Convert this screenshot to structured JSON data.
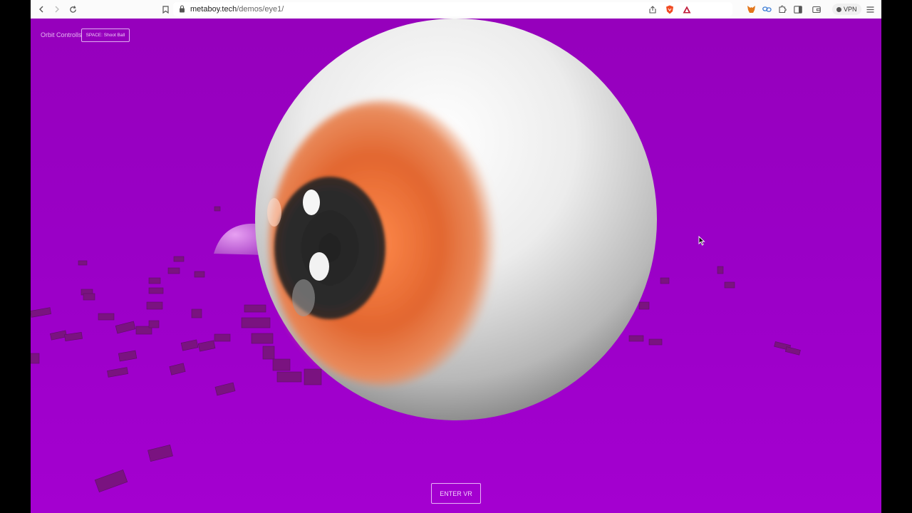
{
  "browser": {
    "url_host": "metaboy.tech",
    "url_path": "/demos/eye1/",
    "vpn_label": "VPN",
    "icons": [
      "back-icon",
      "forward-icon",
      "reload-icon",
      "bookmark-icon",
      "lock-icon",
      "share-icon",
      "brave-shield-icon",
      "brave-rewards-icon",
      "metamask-icon",
      "extension-link-icon",
      "puzzle-icon",
      "sidebar-icon",
      "wallet-icon",
      "menu-icon"
    ]
  },
  "scene": {
    "controls_label": "Orbit Controlls",
    "shoot_button": "SPACE: Shoot Ball",
    "enter_vr_button": "ENTER VR",
    "background_color": "#9c00c4",
    "iris_color": "#e2662f"
  }
}
